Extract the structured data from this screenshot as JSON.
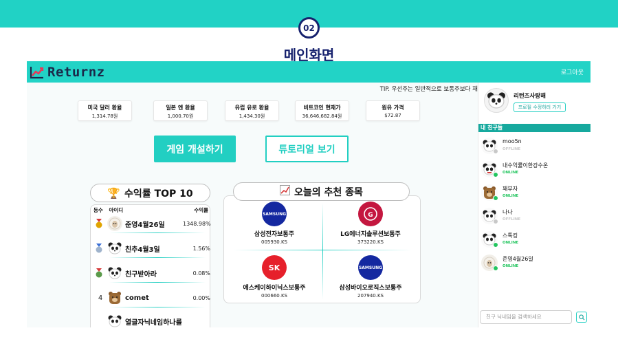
{
  "slide": {
    "step": "02",
    "title": "메인화면"
  },
  "nav": {
    "brand": "Returnz",
    "logout": "로그아웃"
  },
  "tip": "TIP. 우선주는 일반적으로 보통주보다 재",
  "rates": [
    {
      "label": "미국 달러 환율",
      "value": "1,314.78원"
    },
    {
      "label": "일본 엔 환율",
      "value": "1,000.70원"
    },
    {
      "label": "유럽 유로 환율",
      "value": "1,434.30원"
    },
    {
      "label": "비트코인 현재가",
      "value": "36,646,682.84원"
    },
    {
      "label": "원유 가격",
      "value": "$72.87"
    }
  ],
  "actions": {
    "create_game": "게임 개설하기",
    "tutorial": "튜토리얼 보기"
  },
  "ranking": {
    "title": "수익률 TOP 10",
    "col_rank": "등수",
    "col_id": "아이디",
    "col_rate": "수익률",
    "rows": [
      {
        "rank": "",
        "name": "준영4월26일",
        "rate": "1348.98%",
        "medal": "#c8902a"
      },
      {
        "rank": "",
        "name": "친추4월3일",
        "rate": "1.56%",
        "medal": "#5a7fb8"
      },
      {
        "rank": "",
        "name": "친구받아라",
        "rate": "0.08%",
        "medal": "#4a8a4a"
      },
      {
        "rank": "4",
        "name": "comet",
        "rate": "0.00%",
        "medal": ""
      },
      {
        "rank": "",
        "name": "열글자닉네임하나를",
        "rate": "",
        "medal": ""
      }
    ]
  },
  "recommend": {
    "title": "오늘의 추천 종목",
    "items": [
      {
        "name": "삼성전자보통주",
        "code": "005930.KS",
        "logo_text": "SAMSUNG",
        "color": "#1428a0"
      },
      {
        "name": "LG에너지솔루션보통주",
        "code": "373220.KS",
        "logo_text": "LG",
        "color": "#c4173f"
      },
      {
        "name": "에스케이하이닉스보통주",
        "code": "000660.KS",
        "logo_text": "SK",
        "color": "#e6202b"
      },
      {
        "name": "삼성바이오로직스보통주",
        "code": "207940.KS",
        "logo_text": "SAMSUNG",
        "color": "#1428a0"
      }
    ]
  },
  "profile": {
    "name": "리턴즈사랑해",
    "edit_label": "프로필 수정하러 가기"
  },
  "friends": {
    "header": "내 친구들",
    "list": [
      {
        "name": "moo5n",
        "status": "OFFLINE",
        "online": false
      },
      {
        "name": "내수익률이한강수온",
        "status": "ONLINE",
        "online": true
      },
      {
        "name": "꽤부자",
        "status": "ONLINE",
        "online": true
      },
      {
        "name": "나나",
        "status": "OFFLINE",
        "online": false
      },
      {
        "name": "스톡킹",
        "status": "ONLINE",
        "online": true
      },
      {
        "name": "준영4월26일",
        "status": "ONLINE",
        "online": true
      }
    ],
    "search_placeholder": "친구 닉네임을 검색하세요"
  },
  "colors": {
    "accent": "#22d3c6",
    "navy": "#17226e",
    "online": "#22c55e",
    "offline": "#c8c8c8"
  }
}
